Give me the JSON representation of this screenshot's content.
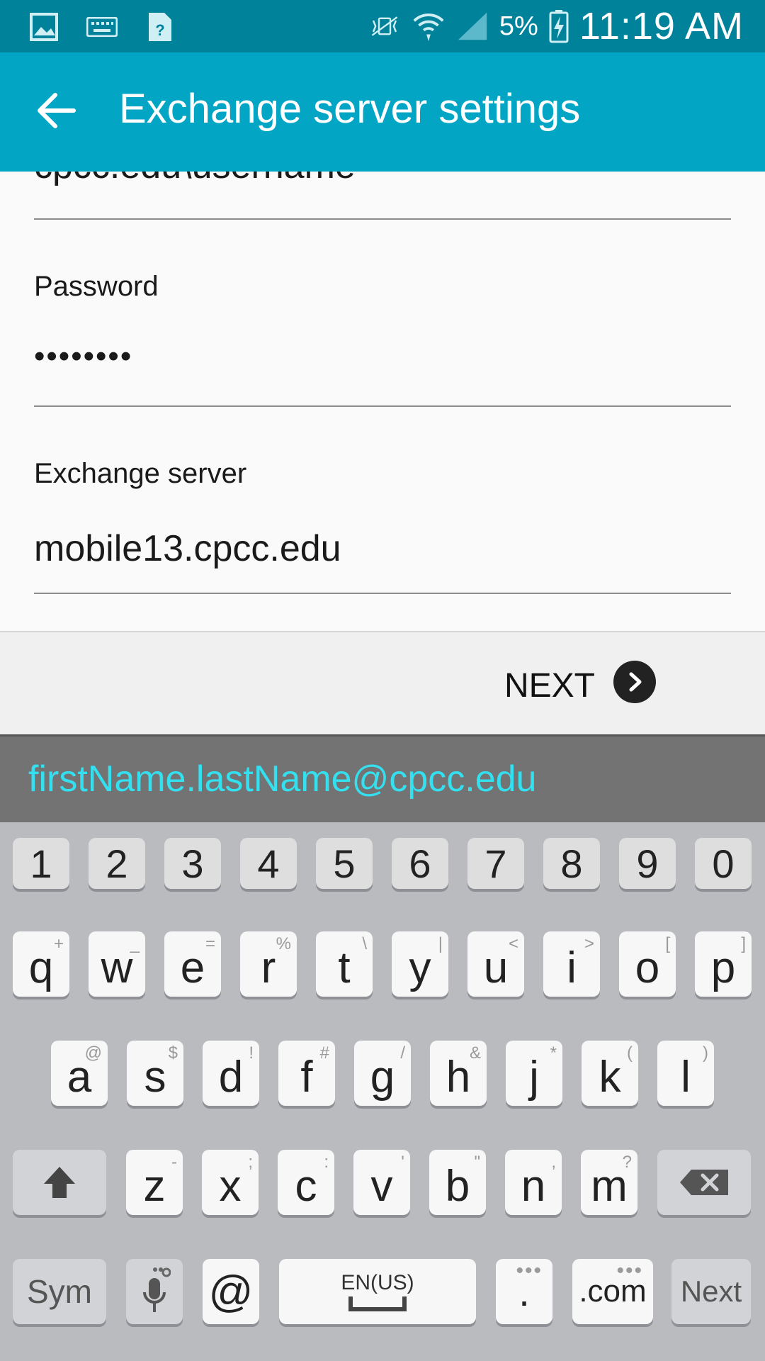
{
  "status_bar": {
    "icons_left": [
      "gallery-icon",
      "keyboard-icon",
      "unknown-file-icon"
    ],
    "icons_right": [
      "vibrate-icon",
      "wifi-icon",
      "signal-icon",
      "battery-charging-icon"
    ],
    "battery_percent": "5%",
    "time": "11:19 AM"
  },
  "app_bar": {
    "title": "Exchange server settings"
  },
  "form": {
    "username_value": "cpcc.edu\\username",
    "password_label": "Password",
    "password_value": "••••••••",
    "server_label": "Exchange server",
    "server_value": "mobile13.cpcc.edu"
  },
  "next_bar": {
    "label": "NEXT"
  },
  "suggestion": "firstName.lastName@cpcc.edu",
  "keyboard": {
    "numbers": [
      "1",
      "2",
      "3",
      "4",
      "5",
      "6",
      "7",
      "8",
      "9",
      "0"
    ],
    "row1": [
      {
        "k": "q",
        "h": "+"
      },
      {
        "k": "w",
        "h": "_"
      },
      {
        "k": "e",
        "h": "="
      },
      {
        "k": "r",
        "h": "%"
      },
      {
        "k": "t",
        "h": "\\"
      },
      {
        "k": "y",
        "h": "|"
      },
      {
        "k": "u",
        "h": "<"
      },
      {
        "k": "i",
        "h": ">"
      },
      {
        "k": "o",
        "h": "["
      },
      {
        "k": "p",
        "h": "]"
      }
    ],
    "row2": [
      {
        "k": "a",
        "h": "@"
      },
      {
        "k": "s",
        "h": "$"
      },
      {
        "k": "d",
        "h": "!"
      },
      {
        "k": "f",
        "h": "#"
      },
      {
        "k": "g",
        "h": "/"
      },
      {
        "k": "h",
        "h": "&"
      },
      {
        "k": "j",
        "h": "*"
      },
      {
        "k": "k",
        "h": "("
      },
      {
        "k": "l",
        "h": ")"
      }
    ],
    "row3": [
      {
        "k": "z",
        "h": "-"
      },
      {
        "k": "x",
        "h": ";"
      },
      {
        "k": "c",
        "h": ":"
      },
      {
        "k": "v",
        "h": "'"
      },
      {
        "k": "b",
        "h": "\""
      },
      {
        "k": "n",
        "h": ","
      },
      {
        "k": "m",
        "h": "?"
      }
    ],
    "sym_label": "Sym",
    "at_label": "@",
    "space_label": "EN(US)",
    "period_label": ".",
    "dotcom_label": ".com",
    "next_label": "Next"
  }
}
